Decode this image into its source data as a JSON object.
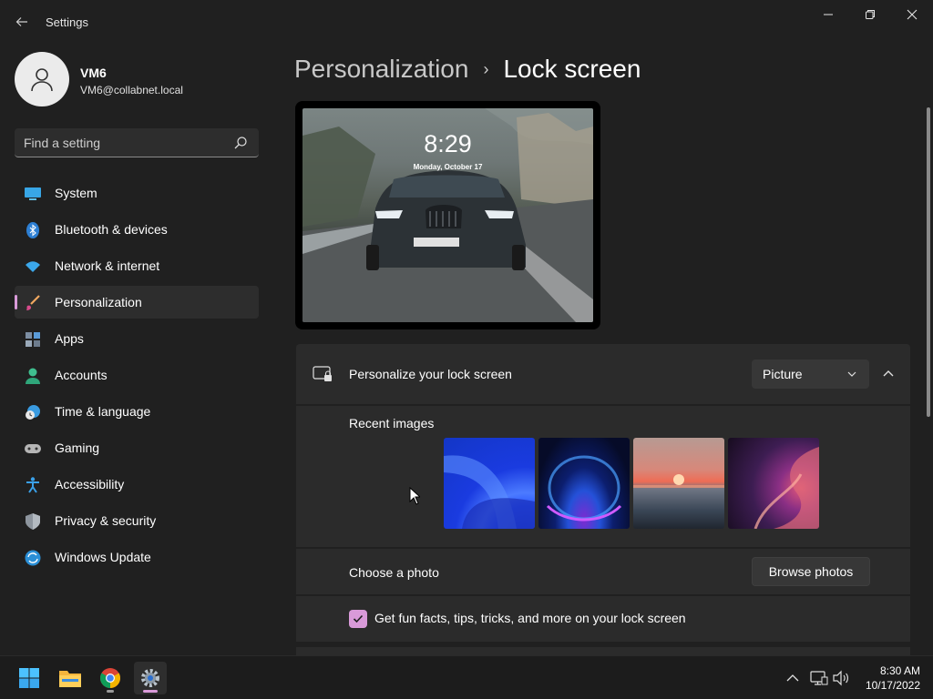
{
  "window": {
    "title": "Settings"
  },
  "user": {
    "name": "VM6",
    "email": "VM6@collabnet.local"
  },
  "search": {
    "placeholder": "Find a setting"
  },
  "sidebar": {
    "items": [
      {
        "label": "System",
        "icon": "system-icon"
      },
      {
        "label": "Bluetooth & devices",
        "icon": "bluetooth-icon"
      },
      {
        "label": "Network & internet",
        "icon": "wifi-icon"
      },
      {
        "label": "Personalization",
        "icon": "brush-icon",
        "active": true
      },
      {
        "label": "Apps",
        "icon": "apps-icon"
      },
      {
        "label": "Accounts",
        "icon": "person-icon"
      },
      {
        "label": "Time & language",
        "icon": "globe-clock-icon"
      },
      {
        "label": "Gaming",
        "icon": "gamepad-icon"
      },
      {
        "label": "Accessibility",
        "icon": "accessibility-icon"
      },
      {
        "label": "Privacy & security",
        "icon": "shield-icon"
      },
      {
        "label": "Windows Update",
        "icon": "update-icon"
      }
    ]
  },
  "breadcrumb": {
    "parent": "Personalization",
    "separator": "›",
    "current": "Lock screen"
  },
  "preview": {
    "time": "8:29",
    "date": "Monday, October 17"
  },
  "lock_setting": {
    "label": "Personalize your lock screen",
    "dropdown_value": "Picture",
    "expanded": true
  },
  "recent": {
    "label": "Recent images",
    "images": [
      "blue-bloom",
      "dark-bloom",
      "sunset-lake",
      "purple-ribbon"
    ]
  },
  "choose_photo": {
    "label": "Choose a photo",
    "button": "Browse photos"
  },
  "tips": {
    "label": "Get fun facts, tips, tricks, and more on your lock screen",
    "checked": true
  },
  "taskbar": {
    "apps": [
      "start-icon",
      "file-explorer-icon",
      "chrome-icon",
      "settings-icon"
    ],
    "time": "8:30 AM",
    "date": "10/17/2022"
  },
  "colors": {
    "accent": "#d99ad9",
    "background": "#202020",
    "card": "#2b2b2b"
  }
}
